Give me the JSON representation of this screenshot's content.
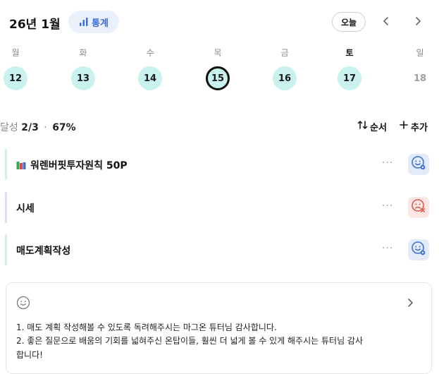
{
  "header": {
    "month_title": "26년 1월",
    "stats_label": "통계",
    "today_label": "오늘",
    "prev_icon": "chevron-left-icon",
    "next_icon": "chevron-right-icon"
  },
  "week": {
    "days": [
      {
        "weekday": "월",
        "date": "12",
        "state": "done"
      },
      {
        "weekday": "화",
        "date": "13",
        "state": "done"
      },
      {
        "weekday": "수",
        "date": "14",
        "state": "done"
      },
      {
        "weekday": "목",
        "date": "15",
        "state": "selected"
      },
      {
        "weekday": "금",
        "date": "16",
        "state": "done"
      },
      {
        "weekday": "토",
        "date": "17",
        "state": "done"
      },
      {
        "weekday": "일",
        "date": "18",
        "state": "empty"
      }
    ]
  },
  "summary": {
    "achieve_label": "달성",
    "achieve_fraction": "2/3",
    "separator": "·",
    "achieve_percent": "67%",
    "order_label": "순서",
    "add_label": "추가"
  },
  "tasks": [
    {
      "title": "워렌버핏투자원칙 50P",
      "more": "···",
      "status": "done",
      "has_book_icon": true,
      "bar_color": "#c9f1ee"
    },
    {
      "title": "시세",
      "more": "···",
      "status": "failed",
      "has_book_icon": false,
      "bar_color": "#dcdcf5"
    },
    {
      "title": "매도계획작성",
      "more": "···",
      "status": "done",
      "has_book_icon": false,
      "bar_color": "#c9f1ee"
    }
  ],
  "memo": {
    "icon": "smile-icon",
    "lines": [
      "1. 매도 계획 작성해볼 수 있도록 독려해주시는 마그온 튜터님 감사합니다.",
      "2. 좋은 질문으로 배움의 기회를 넓혀주신 온탑이들, 훨씬 더 넓게 볼 수 있게 해주시는 튜터님 감사",
      "합니다!"
    ]
  },
  "colors": {
    "accent_teal": "#c9f1ee",
    "stats_blue": "#3b6fd6",
    "done_blue": "#3b6fd6",
    "failed_red": "#e0584f"
  }
}
